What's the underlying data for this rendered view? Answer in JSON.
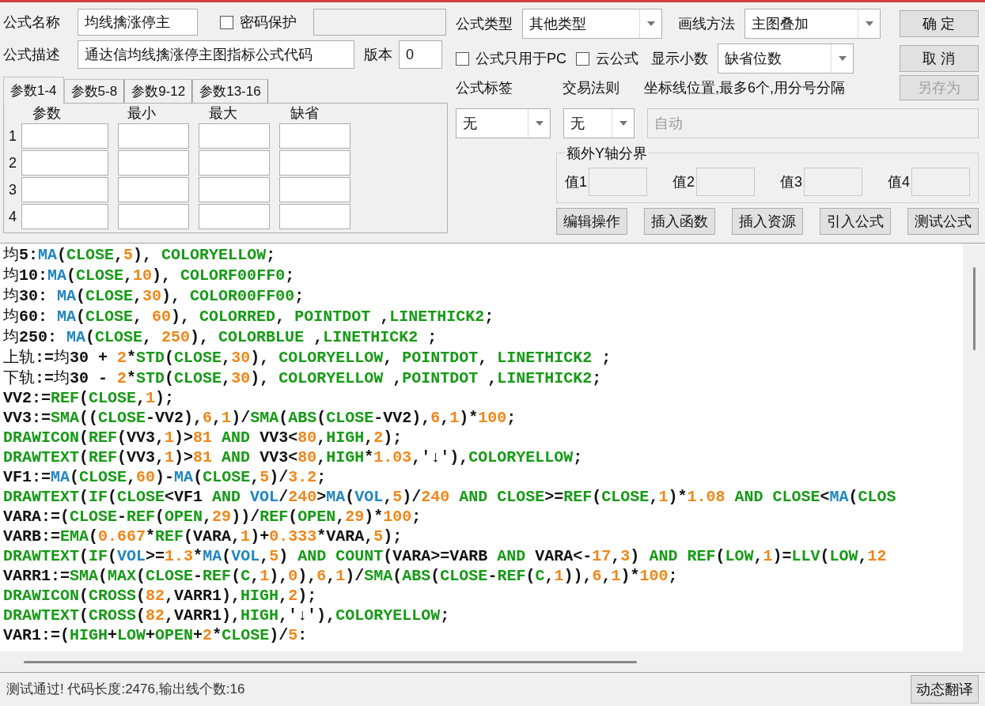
{
  "formula": {
    "name_label": "公式名称",
    "name": "均线擒涨停主",
    "password": {
      "label": "密码保护",
      "checked": false
    },
    "description_label": "公式描述",
    "description": "通达信均线擒涨停主图指标公式代码",
    "version_label": "版本",
    "version": "0"
  },
  "param_tabs": [
    {
      "label": "参数1-4",
      "selected": true
    },
    {
      "label": "参数5-8",
      "selected": false
    },
    {
      "label": "参数9-12",
      "selected": false
    },
    {
      "label": "参数13-16",
      "selected": false
    }
  ],
  "param_columns": [
    "参数",
    "最小",
    "最大",
    "缺省"
  ],
  "param_rows": [
    "1",
    "2",
    "3",
    "4"
  ],
  "formula_type": {
    "label": "公式类型",
    "value": "其他类型"
  },
  "draw_method": {
    "label": "画线方法",
    "value": "主图叠加"
  },
  "pc_only": {
    "label": "公式只用于PC",
    "checked": false
  },
  "cloud": {
    "label": "云公式",
    "checked": false
  },
  "decimals": {
    "label": "显示小数",
    "value": "缺省位数"
  },
  "tag": {
    "label": "公式标签",
    "value": "无"
  },
  "trade_rule": {
    "label": "交易法则",
    "value": "无"
  },
  "axis_lines": {
    "label": "坐标线位置,最多6个,用分号分隔",
    "placeholder": "自动",
    "disabled": true
  },
  "y_bounds": {
    "title": "额外Y轴分界",
    "fields": [
      "值1",
      "值2",
      "值3",
      "值4"
    ]
  },
  "side_buttons": [
    {
      "label": "确 定",
      "disabled": false
    },
    {
      "label": "取 消",
      "disabled": false
    },
    {
      "label": "另存为",
      "disabled": true
    }
  ],
  "tool_buttons": [
    "编辑操作",
    "插入函数",
    "插入资源",
    "引入公式",
    "测试公式"
  ],
  "code_lines": [
    [
      {
        "kind": "c",
        "text": "均"
      },
      {
        "kind": "p",
        "text": "5:"
      },
      {
        "kind": "f",
        "text": "MA"
      },
      {
        "kind": "p",
        "text": "("
      },
      {
        "kind": "k",
        "text": "CLOSE"
      },
      {
        "kind": "p",
        "text": ","
      },
      {
        "kind": "n",
        "text": "5"
      },
      {
        "kind": "p",
        "text": "), "
      },
      {
        "kind": "k",
        "text": "COLORYELLOW"
      },
      {
        "kind": "p",
        "text": ";"
      }
    ],
    [
      {
        "kind": "c",
        "text": "均"
      },
      {
        "kind": "p",
        "text": "10:"
      },
      {
        "kind": "f",
        "text": "MA"
      },
      {
        "kind": "p",
        "text": "("
      },
      {
        "kind": "k",
        "text": "CLOSE"
      },
      {
        "kind": "p",
        "text": ","
      },
      {
        "kind": "n",
        "text": "10"
      },
      {
        "kind": "p",
        "text": "), "
      },
      {
        "kind": "k",
        "text": "COLORF00FF0"
      },
      {
        "kind": "p",
        "text": ";"
      }
    ],
    [
      {
        "kind": "c",
        "text": "均"
      },
      {
        "kind": "p",
        "text": "30: "
      },
      {
        "kind": "f",
        "text": "MA"
      },
      {
        "kind": "p",
        "text": "("
      },
      {
        "kind": "k",
        "text": "CLOSE"
      },
      {
        "kind": "p",
        "text": ","
      },
      {
        "kind": "n",
        "text": "30"
      },
      {
        "kind": "p",
        "text": "), "
      },
      {
        "kind": "k",
        "text": "COLOR00FF00"
      },
      {
        "kind": "p",
        "text": ";"
      }
    ],
    [
      {
        "kind": "c",
        "text": "均"
      },
      {
        "kind": "p",
        "text": "60: "
      },
      {
        "kind": "f",
        "text": "MA"
      },
      {
        "kind": "p",
        "text": "("
      },
      {
        "kind": "k",
        "text": "CLOSE"
      },
      {
        "kind": "p",
        "text": ", "
      },
      {
        "kind": "n",
        "text": "60"
      },
      {
        "kind": "p",
        "text": "), "
      },
      {
        "kind": "k",
        "text": "COLORRED"
      },
      {
        "kind": "p",
        "text": ", "
      },
      {
        "kind": "k",
        "text": "POINTDOT"
      },
      {
        "kind": "p",
        "text": " ,"
      },
      {
        "kind": "k",
        "text": "LINETHICK2"
      },
      {
        "kind": "p",
        "text": ";"
      }
    ],
    [
      {
        "kind": "c",
        "text": "均"
      },
      {
        "kind": "p",
        "text": "250: "
      },
      {
        "kind": "f",
        "text": "MA"
      },
      {
        "kind": "p",
        "text": "("
      },
      {
        "kind": "k",
        "text": "CLOSE"
      },
      {
        "kind": "p",
        "text": ", "
      },
      {
        "kind": "n",
        "text": "250"
      },
      {
        "kind": "p",
        "text": "), "
      },
      {
        "kind": "k",
        "text": "COLORBLUE"
      },
      {
        "kind": "p",
        "text": " ,"
      },
      {
        "kind": "k",
        "text": "LINETHICK2"
      },
      {
        "kind": "p",
        "text": " ;"
      }
    ],
    [
      {
        "kind": "c",
        "text": "上轨"
      },
      {
        "kind": "p",
        "text": ":="
      },
      {
        "kind": "c",
        "text": "均"
      },
      {
        "kind": "p",
        "text": "30 + "
      },
      {
        "kind": "n",
        "text": "2"
      },
      {
        "kind": "p",
        "text": "*"
      },
      {
        "kind": "k",
        "text": "STD"
      },
      {
        "kind": "p",
        "text": "("
      },
      {
        "kind": "k",
        "text": "CLOSE"
      },
      {
        "kind": "p",
        "text": ","
      },
      {
        "kind": "n",
        "text": "30"
      },
      {
        "kind": "p",
        "text": "), "
      },
      {
        "kind": "k",
        "text": "COLORYELLOW"
      },
      {
        "kind": "p",
        "text": ", "
      },
      {
        "kind": "k",
        "text": "POINTDOT"
      },
      {
        "kind": "p",
        "text": ", "
      },
      {
        "kind": "k",
        "text": "LINETHICK2"
      },
      {
        "kind": "p",
        "text": " ;"
      }
    ],
    [
      {
        "kind": "c",
        "text": "下轨"
      },
      {
        "kind": "p",
        "text": ":="
      },
      {
        "kind": "c",
        "text": "均"
      },
      {
        "kind": "p",
        "text": "30 - "
      },
      {
        "kind": "n",
        "text": "2"
      },
      {
        "kind": "p",
        "text": "*"
      },
      {
        "kind": "k",
        "text": "STD"
      },
      {
        "kind": "p",
        "text": "("
      },
      {
        "kind": "k",
        "text": "CLOSE"
      },
      {
        "kind": "p",
        "text": ","
      },
      {
        "kind": "n",
        "text": "30"
      },
      {
        "kind": "p",
        "text": "), "
      },
      {
        "kind": "k",
        "text": "COLORYELLOW"
      },
      {
        "kind": "p",
        "text": " ,"
      },
      {
        "kind": "k",
        "text": "POINTDOT"
      },
      {
        "kind": "p",
        "text": " ,"
      },
      {
        "kind": "k",
        "text": "LINETHICK2"
      },
      {
        "kind": "p",
        "text": ";"
      }
    ],
    [
      {
        "kind": "p",
        "text": "VV2:="
      },
      {
        "kind": "k",
        "text": "REF"
      },
      {
        "kind": "p",
        "text": "("
      },
      {
        "kind": "k",
        "text": "CLOSE"
      },
      {
        "kind": "p",
        "text": ","
      },
      {
        "kind": "n",
        "text": "1"
      },
      {
        "kind": "p",
        "text": ");"
      }
    ],
    [
      {
        "kind": "p",
        "text": "VV3:="
      },
      {
        "kind": "k",
        "text": "SMA"
      },
      {
        "kind": "p",
        "text": "(("
      },
      {
        "kind": "k",
        "text": "CLOSE"
      },
      {
        "kind": "p",
        "text": "-VV2),"
      },
      {
        "kind": "n",
        "text": "6"
      },
      {
        "kind": "p",
        "text": ","
      },
      {
        "kind": "n",
        "text": "1"
      },
      {
        "kind": "p",
        "text": ")/"
      },
      {
        "kind": "k",
        "text": "SMA"
      },
      {
        "kind": "p",
        "text": "("
      },
      {
        "kind": "k",
        "text": "ABS"
      },
      {
        "kind": "p",
        "text": "("
      },
      {
        "kind": "k",
        "text": "CLOSE"
      },
      {
        "kind": "p",
        "text": "-VV2),"
      },
      {
        "kind": "n",
        "text": "6"
      },
      {
        "kind": "p",
        "text": ","
      },
      {
        "kind": "n",
        "text": "1"
      },
      {
        "kind": "p",
        "text": ")*"
      },
      {
        "kind": "n",
        "text": "100"
      },
      {
        "kind": "p",
        "text": ";"
      }
    ],
    [
      {
        "kind": "k",
        "text": "DRAWICON"
      },
      {
        "kind": "p",
        "text": "("
      },
      {
        "kind": "k",
        "text": "REF"
      },
      {
        "kind": "p",
        "text": "(VV3,"
      },
      {
        "kind": "n",
        "text": "1"
      },
      {
        "kind": "p",
        "text": ")>"
      },
      {
        "kind": "n",
        "text": "81"
      },
      {
        "kind": "k",
        "text": " AND"
      },
      {
        "kind": "p",
        "text": " VV3<"
      },
      {
        "kind": "n",
        "text": "80"
      },
      {
        "kind": "p",
        "text": ","
      },
      {
        "kind": "k",
        "text": "HIGH"
      },
      {
        "kind": "p",
        "text": ","
      },
      {
        "kind": "n",
        "text": "2"
      },
      {
        "kind": "p",
        "text": ");"
      }
    ],
    [
      {
        "kind": "k",
        "text": "DRAWTEXT"
      },
      {
        "kind": "p",
        "text": "("
      },
      {
        "kind": "k",
        "text": "REF"
      },
      {
        "kind": "p",
        "text": "(VV3,"
      },
      {
        "kind": "n",
        "text": "1"
      },
      {
        "kind": "p",
        "text": ")>"
      },
      {
        "kind": "n",
        "text": "81"
      },
      {
        "kind": "k",
        "text": " AND"
      },
      {
        "kind": "p",
        "text": " VV3<"
      },
      {
        "kind": "n",
        "text": "80"
      },
      {
        "kind": "p",
        "text": ","
      },
      {
        "kind": "k",
        "text": "HIGH"
      },
      {
        "kind": "p",
        "text": "*"
      },
      {
        "kind": "n",
        "text": "1.03"
      },
      {
        "kind": "p",
        "text": ",'↓'),"
      },
      {
        "kind": "k",
        "text": "COLORYELLOW"
      },
      {
        "kind": "p",
        "text": ";"
      }
    ],
    [
      {
        "kind": "p",
        "text": "VF1:="
      },
      {
        "kind": "f",
        "text": "MA"
      },
      {
        "kind": "p",
        "text": "("
      },
      {
        "kind": "k",
        "text": "CLOSE"
      },
      {
        "kind": "p",
        "text": ","
      },
      {
        "kind": "n",
        "text": "60"
      },
      {
        "kind": "p",
        "text": ")-"
      },
      {
        "kind": "f",
        "text": "MA"
      },
      {
        "kind": "p",
        "text": "("
      },
      {
        "kind": "k",
        "text": "CLOSE"
      },
      {
        "kind": "p",
        "text": ","
      },
      {
        "kind": "n",
        "text": "5"
      },
      {
        "kind": "p",
        "text": ")/"
      },
      {
        "kind": "n",
        "text": "3.2"
      },
      {
        "kind": "p",
        "text": ";"
      }
    ],
    [
      {
        "kind": "k",
        "text": "DRAWTEXT"
      },
      {
        "kind": "p",
        "text": "("
      },
      {
        "kind": "k",
        "text": "IF"
      },
      {
        "kind": "p",
        "text": "("
      },
      {
        "kind": "k",
        "text": "CLOSE"
      },
      {
        "kind": "p",
        "text": "<VF1 "
      },
      {
        "kind": "k",
        "text": "AND "
      },
      {
        "kind": "f",
        "text": "VOL"
      },
      {
        "kind": "p",
        "text": "/"
      },
      {
        "kind": "n",
        "text": "240"
      },
      {
        "kind": "p",
        "text": ">"
      },
      {
        "kind": "f",
        "text": "MA"
      },
      {
        "kind": "p",
        "text": "("
      },
      {
        "kind": "f",
        "text": "VOL"
      },
      {
        "kind": "p",
        "text": ","
      },
      {
        "kind": "n",
        "text": "5"
      },
      {
        "kind": "p",
        "text": ")/"
      },
      {
        "kind": "n",
        "text": "240"
      },
      {
        "kind": "k",
        "text": " AND "
      },
      {
        "kind": "k",
        "text": "CLOSE"
      },
      {
        "kind": "p",
        "text": ">="
      },
      {
        "kind": "k",
        "text": "REF"
      },
      {
        "kind": "p",
        "text": "("
      },
      {
        "kind": "k",
        "text": "CLOSE"
      },
      {
        "kind": "p",
        "text": ","
      },
      {
        "kind": "n",
        "text": "1"
      },
      {
        "kind": "p",
        "text": ")*"
      },
      {
        "kind": "n",
        "text": "1.08"
      },
      {
        "kind": "k",
        "text": " AND "
      },
      {
        "kind": "k",
        "text": "CLOSE"
      },
      {
        "kind": "p",
        "text": "<"
      },
      {
        "kind": "f",
        "text": "MA"
      },
      {
        "kind": "p",
        "text": "("
      },
      {
        "kind": "k",
        "text": "CLOS"
      }
    ],
    [
      {
        "kind": "p",
        "text": "VARA:=("
      },
      {
        "kind": "k",
        "text": "CLOSE"
      },
      {
        "kind": "p",
        "text": "-"
      },
      {
        "kind": "k",
        "text": "REF"
      },
      {
        "kind": "p",
        "text": "("
      },
      {
        "kind": "k",
        "text": "OPEN"
      },
      {
        "kind": "p",
        "text": ","
      },
      {
        "kind": "n",
        "text": "29"
      },
      {
        "kind": "p",
        "text": "))/"
      },
      {
        "kind": "k",
        "text": "REF"
      },
      {
        "kind": "p",
        "text": "("
      },
      {
        "kind": "k",
        "text": "OPEN"
      },
      {
        "kind": "p",
        "text": ","
      },
      {
        "kind": "n",
        "text": "29"
      },
      {
        "kind": "p",
        "text": ")*"
      },
      {
        "kind": "n",
        "text": "100"
      },
      {
        "kind": "p",
        "text": ";"
      }
    ],
    [
      {
        "kind": "p",
        "text": "VARB:="
      },
      {
        "kind": "k",
        "text": "EMA"
      },
      {
        "kind": "p",
        "text": "("
      },
      {
        "kind": "n",
        "text": "0.667"
      },
      {
        "kind": "p",
        "text": "*"
      },
      {
        "kind": "k",
        "text": "REF"
      },
      {
        "kind": "p",
        "text": "(VARA,"
      },
      {
        "kind": "n",
        "text": "1"
      },
      {
        "kind": "p",
        "text": ")+"
      },
      {
        "kind": "n",
        "text": "0.333"
      },
      {
        "kind": "p",
        "text": "*VARA,"
      },
      {
        "kind": "n",
        "text": "5"
      },
      {
        "kind": "p",
        "text": ");"
      }
    ],
    [
      {
        "kind": "k",
        "text": "DRAWTEXT"
      },
      {
        "kind": "p",
        "text": "("
      },
      {
        "kind": "k",
        "text": "IF"
      },
      {
        "kind": "p",
        "text": "("
      },
      {
        "kind": "f",
        "text": "VOL"
      },
      {
        "kind": "p",
        "text": ">="
      },
      {
        "kind": "n",
        "text": "1.3"
      },
      {
        "kind": "p",
        "text": "*"
      },
      {
        "kind": "f",
        "text": "MA"
      },
      {
        "kind": "p",
        "text": "("
      },
      {
        "kind": "f",
        "text": "VOL"
      },
      {
        "kind": "p",
        "text": ","
      },
      {
        "kind": "n",
        "text": "5"
      },
      {
        "kind": "p",
        "text": ") "
      },
      {
        "kind": "k",
        "text": "AND "
      },
      {
        "kind": "k",
        "text": "COUNT"
      },
      {
        "kind": "p",
        "text": "(VARA>=VARB "
      },
      {
        "kind": "k",
        "text": "AND"
      },
      {
        "kind": "p",
        "text": " VARA<-"
      },
      {
        "kind": "n",
        "text": "17"
      },
      {
        "kind": "p",
        "text": ","
      },
      {
        "kind": "n",
        "text": "3"
      },
      {
        "kind": "p",
        "text": ") "
      },
      {
        "kind": "k",
        "text": "AND "
      },
      {
        "kind": "k",
        "text": "REF"
      },
      {
        "kind": "p",
        "text": "("
      },
      {
        "kind": "k",
        "text": "LOW"
      },
      {
        "kind": "p",
        "text": ","
      },
      {
        "kind": "n",
        "text": "1"
      },
      {
        "kind": "p",
        "text": ")="
      },
      {
        "kind": "k",
        "text": "LLV"
      },
      {
        "kind": "p",
        "text": "("
      },
      {
        "kind": "k",
        "text": "LOW"
      },
      {
        "kind": "p",
        "text": ","
      },
      {
        "kind": "n",
        "text": "12"
      }
    ],
    [
      {
        "kind": "p",
        "text": "VARR1:="
      },
      {
        "kind": "k",
        "text": "SMA"
      },
      {
        "kind": "p",
        "text": "("
      },
      {
        "kind": "k",
        "text": "MAX"
      },
      {
        "kind": "p",
        "text": "("
      },
      {
        "kind": "k",
        "text": "CLOSE"
      },
      {
        "kind": "p",
        "text": "-"
      },
      {
        "kind": "k",
        "text": "REF"
      },
      {
        "kind": "p",
        "text": "("
      },
      {
        "kind": "k",
        "text": "C"
      },
      {
        "kind": "p",
        "text": ","
      },
      {
        "kind": "n",
        "text": "1"
      },
      {
        "kind": "p",
        "text": "),"
      },
      {
        "kind": "n",
        "text": "0"
      },
      {
        "kind": "p",
        "text": "),"
      },
      {
        "kind": "n",
        "text": "6"
      },
      {
        "kind": "p",
        "text": ","
      },
      {
        "kind": "n",
        "text": "1"
      },
      {
        "kind": "p",
        "text": ")/"
      },
      {
        "kind": "k",
        "text": "SMA"
      },
      {
        "kind": "p",
        "text": "("
      },
      {
        "kind": "k",
        "text": "ABS"
      },
      {
        "kind": "p",
        "text": "("
      },
      {
        "kind": "k",
        "text": "CLOSE"
      },
      {
        "kind": "p",
        "text": "-"
      },
      {
        "kind": "k",
        "text": "REF"
      },
      {
        "kind": "p",
        "text": "("
      },
      {
        "kind": "k",
        "text": "C"
      },
      {
        "kind": "p",
        "text": ","
      },
      {
        "kind": "n",
        "text": "1"
      },
      {
        "kind": "p",
        "text": ")),"
      },
      {
        "kind": "n",
        "text": "6"
      },
      {
        "kind": "p",
        "text": ","
      },
      {
        "kind": "n",
        "text": "1"
      },
      {
        "kind": "p",
        "text": ")*"
      },
      {
        "kind": "n",
        "text": "100"
      },
      {
        "kind": "p",
        "text": ";"
      }
    ],
    [
      {
        "kind": "k",
        "text": "DRAWICON"
      },
      {
        "kind": "p",
        "text": "("
      },
      {
        "kind": "k",
        "text": "CROSS"
      },
      {
        "kind": "p",
        "text": "("
      },
      {
        "kind": "n",
        "text": "82"
      },
      {
        "kind": "p",
        "text": ",VARR1),"
      },
      {
        "kind": "k",
        "text": "HIGH"
      },
      {
        "kind": "p",
        "text": ","
      },
      {
        "kind": "n",
        "text": "2"
      },
      {
        "kind": "p",
        "text": ");"
      }
    ],
    [
      {
        "kind": "k",
        "text": "DRAWTEXT"
      },
      {
        "kind": "p",
        "text": "("
      },
      {
        "kind": "k",
        "text": "CROSS"
      },
      {
        "kind": "p",
        "text": "("
      },
      {
        "kind": "n",
        "text": "82"
      },
      {
        "kind": "p",
        "text": ",VARR1),"
      },
      {
        "kind": "k",
        "text": "HIGH"
      },
      {
        "kind": "p",
        "text": ",'↓'),"
      },
      {
        "kind": "k",
        "text": "COLORYELLOW"
      },
      {
        "kind": "p",
        "text": ";"
      }
    ],
    [
      {
        "kind": "p",
        "text": "VAR1:=("
      },
      {
        "kind": "k",
        "text": "HIGH"
      },
      {
        "kind": "p",
        "text": "+"
      },
      {
        "kind": "k",
        "text": "LOW"
      },
      {
        "kind": "p",
        "text": "+"
      },
      {
        "kind": "k",
        "text": "OPEN"
      },
      {
        "kind": "p",
        "text": "+"
      },
      {
        "kind": "n",
        "text": "2"
      },
      {
        "kind": "p",
        "text": "*"
      },
      {
        "kind": "k",
        "text": "CLOSE"
      },
      {
        "kind": "p",
        "text": ")/"
      },
      {
        "kind": "n",
        "text": "5"
      },
      {
        "kind": "p",
        "text": ":"
      }
    ]
  ],
  "status": "测试通过! 代码长度:2476,输出线个数:16",
  "translate_button": "动态翻译"
}
